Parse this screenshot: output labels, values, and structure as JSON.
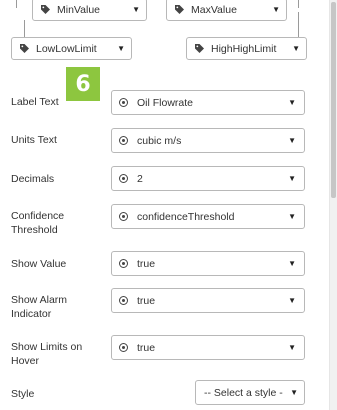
{
  "limits": {
    "min_value": "MinValue",
    "max_value": "MaxValue",
    "low_low_limit": "LowLowLimit",
    "high_high_limit": "HighHighLimit"
  },
  "step_badge": "6",
  "rows": [
    {
      "label": "Label Text",
      "value": "Oil Flowrate"
    },
    {
      "label": "Units Text",
      "value": "cubic m/s"
    },
    {
      "label": "Decimals",
      "value": "2"
    },
    {
      "label": "Confidence Threshold",
      "value": "confidenceThreshold"
    },
    {
      "label": "Show Value",
      "value": "true"
    },
    {
      "label": "Show Alarm Indicator",
      "value": "true"
    },
    {
      "label": "Show Limits on Hover",
      "value": "true"
    }
  ],
  "style": {
    "label": "Style",
    "placeholder": "-- Select a style -"
  },
  "icons": {
    "tag": "tag-icon",
    "variable": "circle-dot-icon",
    "dropdown": "caret-down-icon"
  },
  "colors": {
    "badge": "#8dc63f",
    "border": "#b8b8b8"
  }
}
